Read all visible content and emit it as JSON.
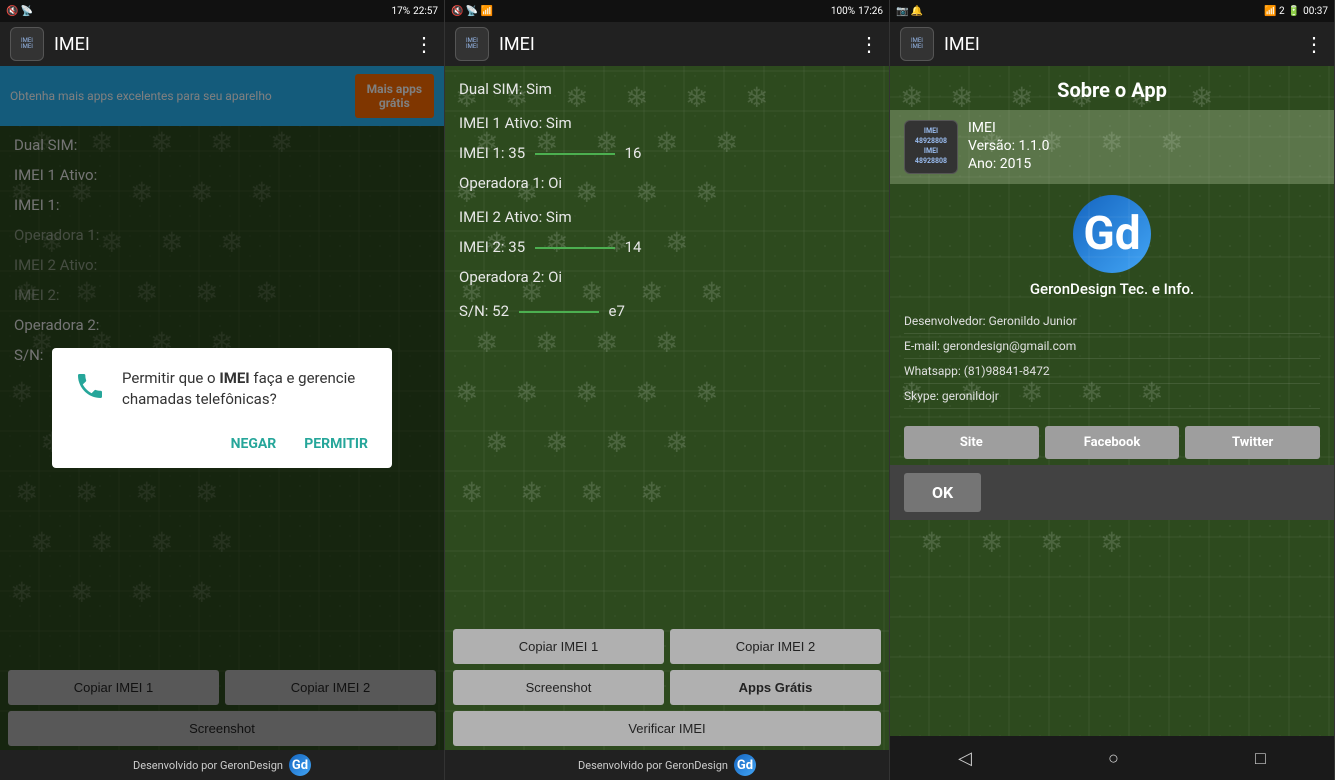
{
  "phone1": {
    "statusBar": {
      "left": "🔇 📶 📡 17%",
      "time": "22:57",
      "battery": "17%"
    },
    "appBar": {
      "title": "IMEI",
      "menuIcon": "⋮"
    },
    "promoBanner": {
      "text": "Obtenha mais apps excelentes para seu aparelho",
      "buttonLine1": "Mais apps",
      "buttonLine2": "grátis"
    },
    "fields": {
      "dualSim": "Dual SIM:",
      "imei1Ativo": "IMEI 1 Ativo:",
      "imei1": "IMEI 1:",
      "operadora1": "Operadora 1:",
      "imei2Ativo": "IMEI 2 Ativo:",
      "imei2": "IMEI 2:",
      "operadora2": "Operadora 2:",
      "sn": "S/N:"
    },
    "buttons": {
      "copiarImei1": "Copiar IMEI 1",
      "copiarImei2": "Copiar IMEI 2",
      "screenshot": "Screenshot"
    },
    "footer": {
      "text": "Desenvolvido por GeronDesign",
      "logoText": "Gd"
    },
    "dialog": {
      "message1": "Permitir que o ",
      "boldWord": "IMEI",
      "message2": " faça e gerencie chamadas telefônicas?",
      "btnNegar": "NEGAR",
      "btnPermitir": "PERMITIR"
    }
  },
  "phone2": {
    "statusBar": {
      "time": "17:26",
      "battery": "100%"
    },
    "appBar": {
      "title": "IMEI",
      "menuIcon": "⋮"
    },
    "data": {
      "dualSim": "Dual SIM:  Sim",
      "imei1Ativo": "IMEI 1 Ativo:  Sim",
      "imei1Label": "IMEI 1:  35",
      "imei1End": "16",
      "operadora1": "Operadora 1:  Oi",
      "imei2Ativo": "IMEI 2 Ativo:  Sim",
      "imei2Label": "IMEI 2:  35",
      "imei2End": "14",
      "operadora2": "Operadora 2:  Oi",
      "snLabel": "S/N:  52",
      "snEnd": "e7"
    },
    "buttons": {
      "copiarImei1": "Copiar IMEI 1",
      "copiarImei2": "Copiar IMEI 2",
      "screenshot": "Screenshot",
      "appsGratis": "Apps Grátis",
      "verificarImei": "Verificar IMEI"
    },
    "footer": {
      "text": "Desenvolvido por GeronDesign",
      "logoText": "Gd"
    }
  },
  "phone3": {
    "statusBar": {
      "time": "00:37"
    },
    "appBar": {
      "title": "IMEI",
      "menuIcon": "⋮"
    },
    "about": {
      "title": "Sobre o App",
      "appName": "IMEI",
      "version": "Versão: 1.1.0",
      "year": "Ano: 2015",
      "logoText": "Gd",
      "companyName": "GeronDesign Tec. e Info.",
      "developer": "Desenvolvedor: Geronildo Junior",
      "email": "E-mail: gerondesign@gmail.com",
      "whatsapp": "Whatsapp: (81)98841-8472",
      "skype": "Skype: geronildojr",
      "btnSite": "Site",
      "btnFacebook": "Facebook",
      "btnTwitter": "Twitter",
      "btnOk": "OK"
    },
    "navBar": {
      "back": "◁",
      "home": "○",
      "recent": "□"
    }
  }
}
